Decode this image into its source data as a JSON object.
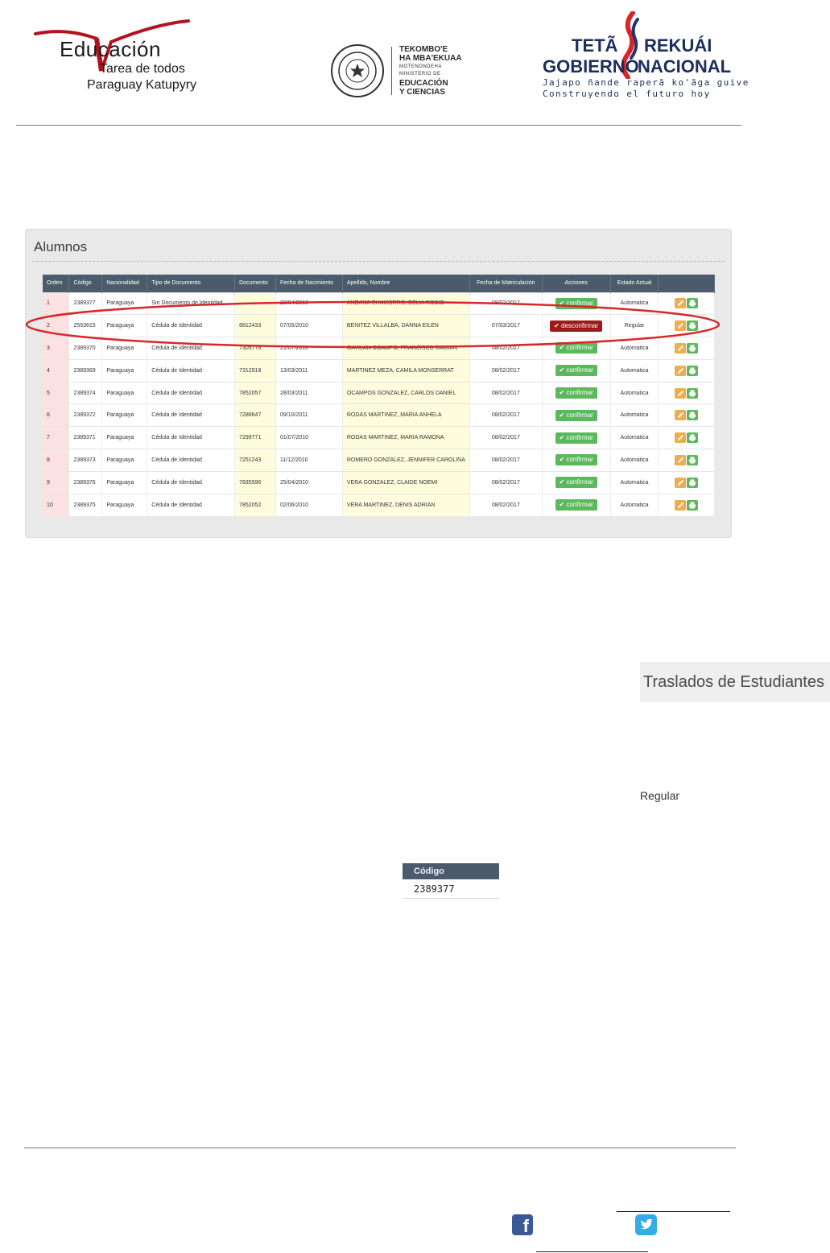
{
  "header": {
    "educacion": {
      "title": "Educación",
      "line1": "Tarea de todos",
      "line2": "Paraguay Katupyry"
    },
    "ministerio": {
      "line1": "TEKOMBO'E",
      "line2": "HA MBA'EKUAA",
      "line3": "MOTENONDEHA",
      "line4": "MINISTERIO DE",
      "line5": "EDUCACIÓN",
      "line6": "Y CIENCIAS"
    },
    "gobierno": {
      "w1": "TETÃ",
      "w2": "REKUÁI",
      "w3": "GOBIERNO",
      "w4": "NACIONAL",
      "slogan1": "Jajapo ñande raperã ko'ãga guive",
      "slogan2": "Construyendo el futuro hoy"
    }
  },
  "panel": {
    "title": "Alumnos",
    "columns": {
      "orden": "Orden",
      "codigo": "Código",
      "nacionalidad": "Nacionalidad",
      "tipo": "Tipo de Documento",
      "documento": "Documento",
      "nacimiento": "Fecha de Nacimiento",
      "nombre": "Apellido, Nombre",
      "matriculacion": "Fecha de Matriculación",
      "acciones": "Acciones",
      "estado": "Estado Actual"
    },
    "rows": [
      {
        "orden": "1",
        "codigo": "2389377",
        "nacionalidad": "Paraguaya",
        "tipo": "Sin Documento de Identidad",
        "documento": "",
        "nacimiento": "23/04/2010",
        "nombre": "ANDANA CHAMORRO, DELIA ROCIO",
        "matriculacion": "08/02/2017",
        "accion": "confirmar",
        "estado": "Automatica"
      },
      {
        "orden": "2",
        "codigo": "2553615",
        "nacionalidad": "Paraguaya",
        "tipo": "Cédula de Identidad",
        "documento": "6812433",
        "nacimiento": "07/05/2010",
        "nombre": "BENITEZ VILLALBA, DANNA EILEN",
        "matriculacion": "07/03/2017",
        "accion": "desconfirmar",
        "estado": "Regular"
      },
      {
        "orden": "3",
        "codigo": "2389370",
        "nacionalidad": "Paraguaya",
        "tipo": "Cédula de Identidad",
        "documento": "7305776",
        "nacimiento": "21/07/2010",
        "nombre": "GAVILAN OCAMPO, FRANCISCO DAMIAN",
        "matriculacion": "08/02/2017",
        "accion": "confirmar",
        "estado": "Automatica"
      },
      {
        "orden": "4",
        "codigo": "2389369",
        "nacionalidad": "Paraguaya",
        "tipo": "Cédula de Identidad",
        "documento": "7312918",
        "nacimiento": "13/03/2011",
        "nombre": "MARTINEZ MEZA, CAMILA MONSERRAT",
        "matriculacion": "08/02/2017",
        "accion": "confirmar",
        "estado": "Automatica"
      },
      {
        "orden": "5",
        "codigo": "2389374",
        "nacionalidad": "Paraguaya",
        "tipo": "Cédula de Identidad",
        "documento": "7852057",
        "nacimiento": "28/03/2011",
        "nombre": "OCAMPOS GONZALEZ, CARLOS DANIEL",
        "matriculacion": "08/02/2017",
        "accion": "confirmar",
        "estado": "Automatica"
      },
      {
        "orden": "6",
        "codigo": "2389372",
        "nacionalidad": "Paraguaya",
        "tipo": "Cédula de Identidad",
        "documento": "7288647",
        "nacimiento": "09/10/2011",
        "nombre": "RODAS MARTINEZ, MARIA ANHELA",
        "matriculacion": "08/02/2017",
        "accion": "confirmar",
        "estado": "Automatica"
      },
      {
        "orden": "7",
        "codigo": "2389371",
        "nacionalidad": "Paraguaya",
        "tipo": "Cédula de Identidad",
        "documento": "7299771",
        "nacimiento": "01/07/2010",
        "nombre": "RODAS MARTINEZ, MARIA RAMONA",
        "matriculacion": "08/02/2017",
        "accion": "confirmar",
        "estado": "Automatica"
      },
      {
        "orden": "8",
        "codigo": "2389373",
        "nacionalidad": "Paraguaya",
        "tipo": "Cédula de Identidad",
        "documento": "7251243",
        "nacimiento": "11/12/2010",
        "nombre": "ROMERO GONZALEZ, JENNIFER CAROLINA",
        "matriculacion": "08/02/2017",
        "accion": "confirmar",
        "estado": "Automatica"
      },
      {
        "orden": "9",
        "codigo": "2389376",
        "nacionalidad": "Paraguaya",
        "tipo": "Cédula de Identidad",
        "documento": "7835596",
        "nacimiento": "25/04/2010",
        "nombre": "VERA GONZALEZ, CLAIDE NOEMI",
        "matriculacion": "08/02/2017",
        "accion": "confirmar",
        "estado": "Automatica"
      },
      {
        "orden": "10",
        "codigo": "2389375",
        "nacionalidad": "Paraguaya",
        "tipo": "Cédula de Identidad",
        "documento": "7852052",
        "nacimiento": "02/06/2010",
        "nombre": "VERA MARTINEZ, DENIS ADRIAN",
        "matriculacion": "08/02/2017",
        "accion": "confirmar",
        "estado": "Automatica"
      }
    ],
    "icons": {
      "confirm": "check-icon",
      "edit": "pencil-icon",
      "print": "printer-icon"
    },
    "colors": {
      "header": "#4c5b6b",
      "confirm": "#5cb85c",
      "desconfirm": "#9b1b1b",
      "edit": "#f0ad4e",
      "highlight": "#d9262c"
    }
  },
  "fragments": {
    "traslados": "Traslados de Estudiantes",
    "regular": "Regular",
    "codigo_header": "Código",
    "codigo_value": "2389377"
  },
  "footer": {
    "icons": [
      "facebook-icon",
      "twitter-icon"
    ]
  }
}
